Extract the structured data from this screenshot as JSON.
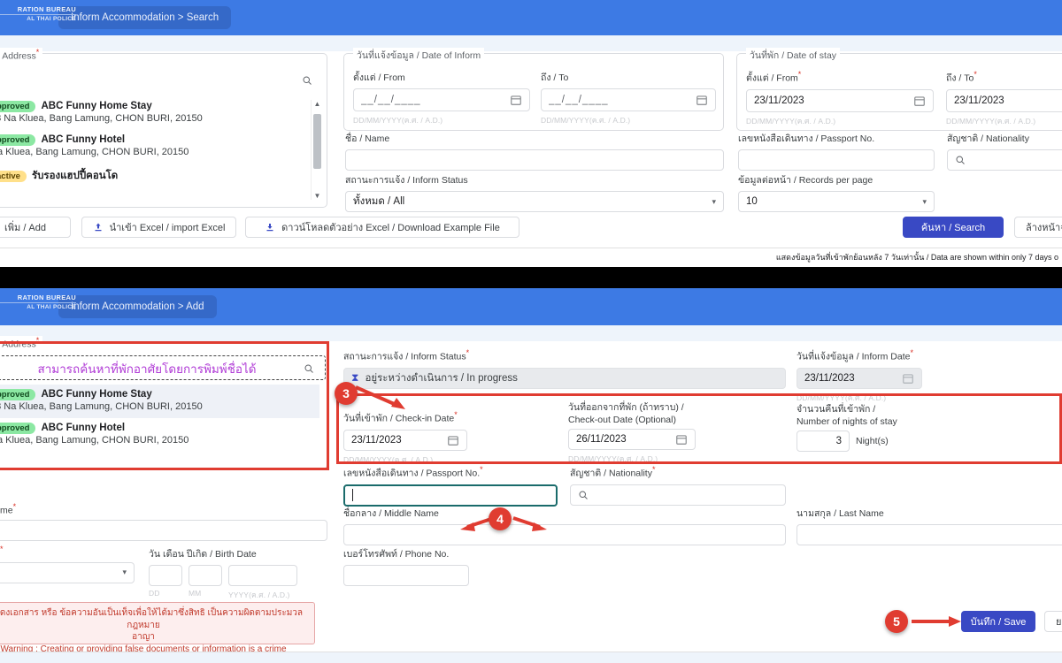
{
  "app": {
    "logo_line1": "RATION BUREAU",
    "logo_line2": "AL THAI POLICE",
    "brand_blue": "#3d7ae4"
  },
  "search_panel": {
    "breadcrumb": "Inform Accommodation > Search",
    "address_fieldset_legend": " / Address",
    "search_placeholder": "",
    "results": [
      {
        "status": "pproved",
        "status_type": "green",
        "name": "ABC Funny Home Stay",
        "address": "53 Na Kluea, Bang Lamung, CHON BURI, 20150"
      },
      {
        "status": "pproved",
        "status_type": "green",
        "name": "ABC Funny Hotel",
        "address": "Na Kluea, Bang Lamung, CHON BURI, 20150"
      },
      {
        "status": "active",
        "status_type": "yellow",
        "name": "รับรองแฮปปี้คอนโด",
        "address": ""
      }
    ],
    "buttons": {
      "add": "เพิ่ม / Add",
      "import": "นำเข้า Excel / import Excel",
      "download": "ดาวน์โหลดตัวอย่าง Excel / Download Example File",
      "search": "ค้นหา / Search",
      "clear": "ล้างหน้าจ"
    },
    "date_of_inform": {
      "legend": "วันที่แจ้งข้อมูล / Date of Inform",
      "from_label": "ตั้งแต่ / From",
      "from_value": "__/__/____",
      "to_label": "ถึง / To",
      "to_value": "__/__/____",
      "hint": "DD/MM/YYYY(ค.ศ. / A.D.)"
    },
    "name": {
      "label": "ชื่อ / Name",
      "value": ""
    },
    "inform_status": {
      "label": "สถานะการแจ้ง / Inform Status",
      "value": "ทั้งหมด / All"
    },
    "date_of_stay": {
      "legend": "วันที่พัก / Date of stay",
      "from_label": "ตั้งแต่ / From",
      "from_value": "23/11/2023",
      "to_label": "ถึง / To",
      "to_value": "23/11/2023",
      "hint": "DD/MM/YYYY(ค.ศ. / A.D.)"
    },
    "passport": {
      "label": "เลขหนังสือเดินทาง / Passport No.",
      "value": ""
    },
    "nationality": {
      "label": "สัญชาติ / Nationality",
      "value": ""
    },
    "records_per_page": {
      "label": "ข้อมูลต่อหน้า / Records per page",
      "value": "10"
    },
    "footnote": "แสดงข้อมูลวันที่เข้าพักย้อนหลัง 7 วันเท่านั้น / Data are shown within only 7 days o"
  },
  "add_panel": {
    "breadcrumb": "Inform Accommodation > Add",
    "address_fieldset_legend": " / Address",
    "search_hint_text": "สามารถค้นหาที่พักอาศัยโดยการพิมพ์ชื่อได้",
    "results": [
      {
        "status": "pproved",
        "status_type": "green",
        "name": "ABC Funny Home Stay",
        "address": "53 Na Kluea, Bang Lamung, CHON BURI, 20150"
      },
      {
        "status": "pproved",
        "status_type": "green",
        "name": "ABC Funny Hotel",
        "address": "Na Kluea, Bang Lamung, CHON BURI, 20150"
      }
    ],
    "inform_status": {
      "label": "สถานะการแจ้ง / Inform Status",
      "value": "อยู่ระหว่างดำเนินการ / In progress",
      "icon": "hourglass-icon"
    },
    "inform_date": {
      "label": "วันที่แจ้งข้อมูล / Inform Date",
      "value": "23/11/2023",
      "hint": "DD/MM/YYYY(ค.ศ. / A.D.)"
    },
    "checkin": {
      "label": "วันที่เข้าพัก / Check-in Date",
      "value": "23/11/2023",
      "hint": "DD/MM/YYYY(ค.ศ. / A.D.)"
    },
    "checkout": {
      "label_line1": "วันที่ออกจากที่พัก (ถ้าทราบ) /",
      "label_line2": "Check-out Date (Optional)",
      "value": "26/11/2023",
      "hint": "DD/MM/YYYY(ค.ศ. / A.D.)"
    },
    "nights": {
      "label_line1": "จำนวนคืนที่เข้าพัก /",
      "label_line2": "Number of nights of stay",
      "value": "3",
      "unit": "Night(s)"
    },
    "passport": {
      "label": "เลขหนังสือเดินทาง / Passport No.",
      "value": ""
    },
    "nationality": {
      "label": "สัญชาติ / Nationality",
      "value": ""
    },
    "first_name": {
      "label": "me",
      "value": ""
    },
    "middle_name": {
      "label": "ชื่อกลาง / Middle Name",
      "value": ""
    },
    "last_name": {
      "label": "นามสกุล / Last Name",
      "value": ""
    },
    "gender": {
      "label": "",
      "value": ""
    },
    "birth_date": {
      "label": "วัน เดือน ปีเกิด / Birth Date",
      "dd": "DD",
      "mm": "MM",
      "yyyy": "YYYY(ค.ศ. / A.D.)"
    },
    "phone": {
      "label": "เบอร์โทรศัพท์ / Phone No.",
      "value": ""
    },
    "warning_line1": "รแสดงเอกสาร หรือ ข้อความอันเป็นเท็จเพื่อให้ได้มาซึ่งสิทธิ เป็นความผิดตามประมวลกฎหมาย",
    "warning_line2": "อาญา",
    "warning_line3": "Warning : Creating or providing false documents or information is a crime",
    "buttons": {
      "save": "บันทึก / Save",
      "cancel": "ยก"
    }
  },
  "annotations": {
    "markers": [
      {
        "id": "3",
        "label": "3"
      },
      {
        "id": "4",
        "label": "4"
      },
      {
        "id": "5",
        "label": "5"
      }
    ],
    "highlight_color": "#e03c31"
  }
}
